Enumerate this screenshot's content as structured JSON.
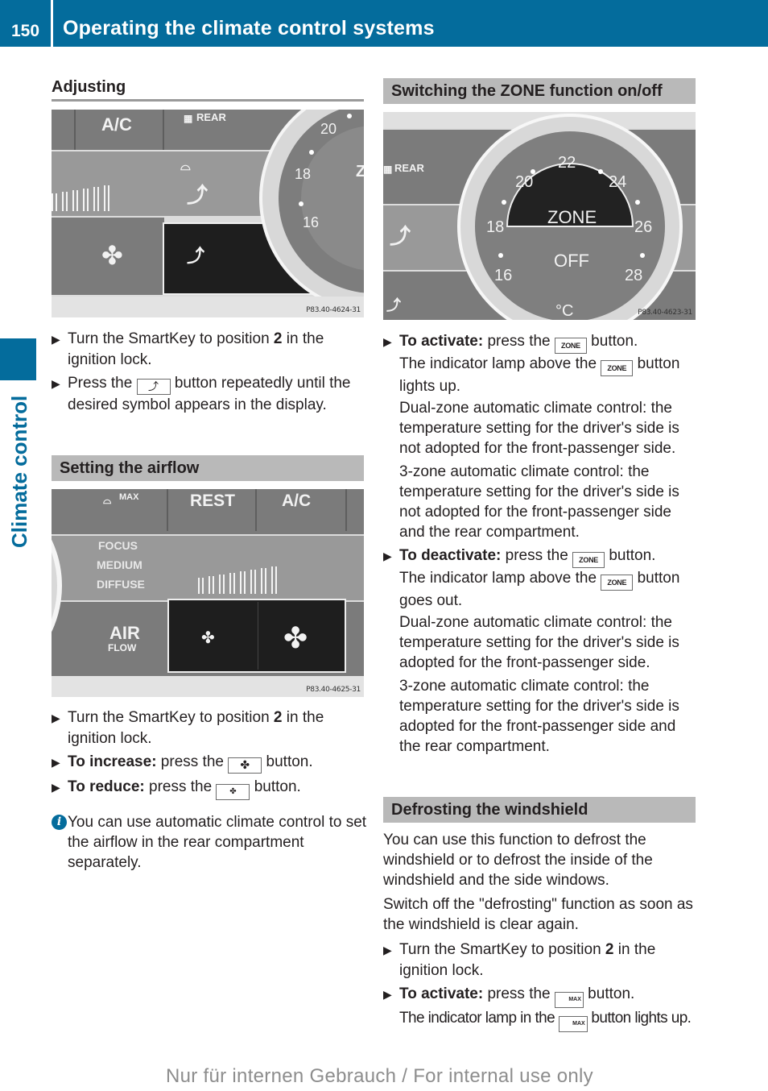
{
  "header": {
    "page_number": "150",
    "title": "Operating the climate control systems"
  },
  "side_tab": {
    "label": "Climate control"
  },
  "left_column": {
    "adjusting": {
      "heading": "Adjusting",
      "figure": {
        "code": "P83.40-4624-31",
        "labels": {
          "ac": "A/C",
          "rear": "REAR",
          "temps": [
            "20",
            "18",
            "16"
          ],
          "dial_partial": "Z"
        },
        "icons": [
          "rear-defrost-icon",
          "windshield-icon",
          "airflow-seat-icon",
          "fan-icon",
          "airflow-mode-icon"
        ]
      },
      "steps": [
        {
          "pre": "Turn the SmartKey to position ",
          "bold": "2",
          "post": " in the ignition lock."
        },
        {
          "pre": "Press the ",
          "key_icon": "airflow-distribution-icon",
          "post": " button repeatedly until the desired symbol appears in the display."
        }
      ]
    },
    "airflow": {
      "heading": "Setting the airflow",
      "figure": {
        "code": "P83.40-4625-31",
        "labels": {
          "max": "MAX",
          "rest": "REST",
          "ac": "A/C",
          "focus": "FOCUS",
          "medium": "MEDIUM",
          "diffuse": "DIFFUSE",
          "air": "AIR",
          "flow": "FLOW"
        },
        "icons": [
          "defrost-max-icon",
          "fan-small-icon",
          "fan-large-icon"
        ]
      },
      "steps": [
        {
          "pre": "Turn the SmartKey to position ",
          "bold": "2",
          "post": " in the ignition lock."
        },
        {
          "bold_lead": "To increase:",
          "pre": " press the ",
          "key_icon": "fan-large-icon",
          "post": " button."
        },
        {
          "bold_lead": "To reduce:",
          "pre": " press the ",
          "key_icon": "fan-small-icon",
          "post": " button."
        }
      ],
      "info": "You can use automatic climate control to set the airflow in the rear compartment separately."
    }
  },
  "right_column": {
    "zone": {
      "heading": "Switching the ZONE function on/off",
      "figure": {
        "code": "P83.40-4623-31",
        "labels": {
          "rear": "REAR",
          "zone": "ZONE",
          "off": "OFF",
          "unit": "°C",
          "temps": [
            "16",
            "18",
            "20",
            "22",
            "24",
            "26",
            "28"
          ]
        }
      },
      "key_label": "ZONE",
      "activate": {
        "lead": "To activate:",
        "line1_pre": " press the ",
        "line1_post": " button.",
        "line2_pre": "The indicator lamp above the ",
        "line2_post": " button lights up.",
        "dual": "Dual-zone automatic climate control: the temperature setting for the driver's side is not adopted for the front-passenger side.",
        "three": "3-zone automatic climate control: the temperature setting for the driver's side is not adopted for the front-passenger side and the rear compartment."
      },
      "deactivate": {
        "lead": "To deactivate:",
        "line1_pre": " press the ",
        "line1_post": " button.",
        "line2_pre": "The indicator lamp above the ",
        "line2_post": " button goes out.",
        "dual": "Dual-zone automatic climate control: the temperature setting for the driver's side is adopted for the front-passenger side.",
        "three": "3-zone automatic climate control: the temperature setting for the driver's side is adopted for the front-passenger side and the rear compartment."
      }
    },
    "defrost": {
      "heading": "Defrosting the windshield",
      "para1": "You can use this function to defrost the windshield or to defrost the inside of the windshield and the side windows.",
      "para2": "Switch off the \"defrosting\" function as soon as the windshield is clear again.",
      "step1": {
        "pre": "Turn the SmartKey to position ",
        "bold": "2",
        "post": " in the ignition lock."
      },
      "step2": {
        "lead": "To activate:",
        "line1_pre": " press the ",
        "line1_post": " button.",
        "line2_pre": "The indicator lamp in the ",
        "line2_post": " button lights up."
      },
      "max_key_label": "MAX"
    }
  },
  "footer": {
    "text": "Nur für internen Gebrauch / For internal use only"
  },
  "colors": {
    "brand_blue": "#046c9c",
    "heading_box": "#b9b9b9",
    "text": "#231f20"
  }
}
